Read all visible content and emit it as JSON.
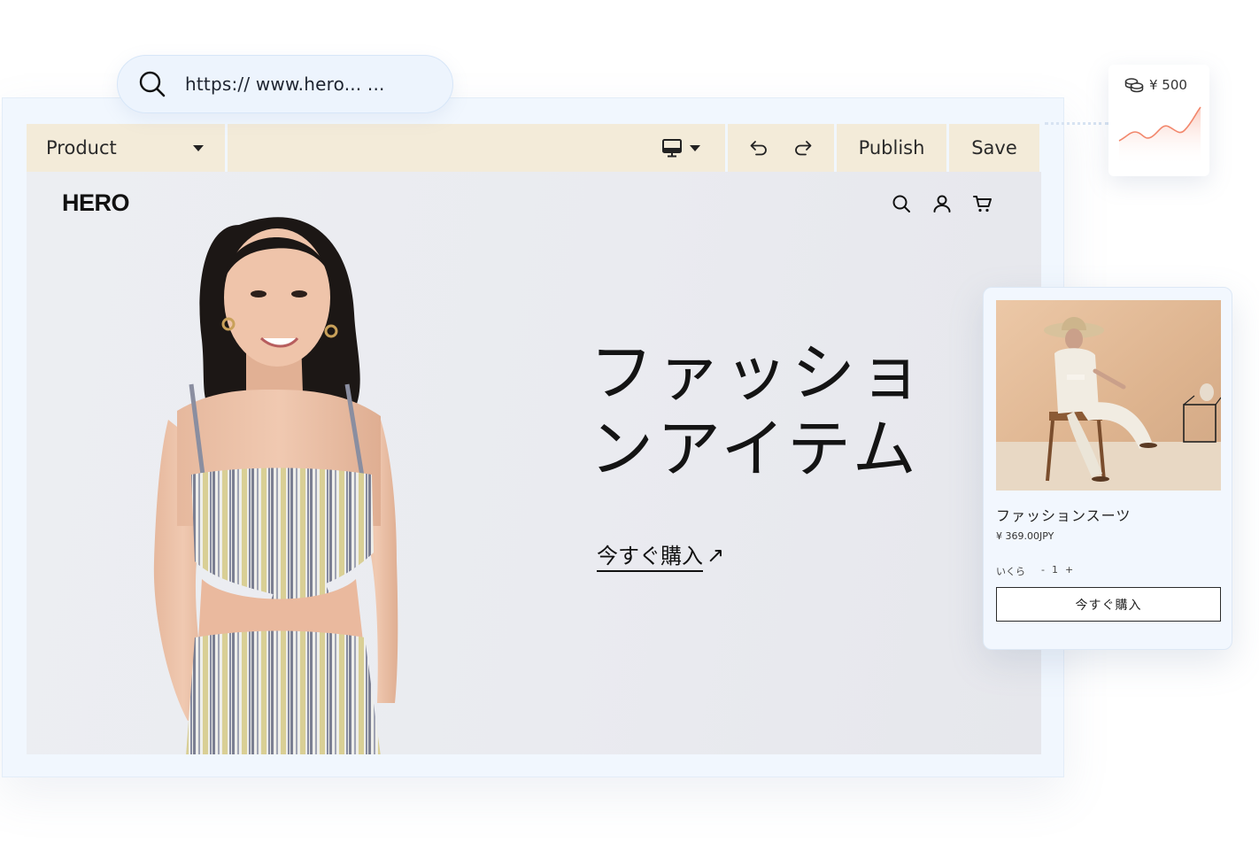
{
  "url_bar": {
    "url": "https:// www.hero... ..."
  },
  "toolbar": {
    "product_label": "Product",
    "publish_label": "Publish",
    "save_label": "Save",
    "icons": [
      "monitor-icon",
      "undo-icon",
      "redo-icon"
    ]
  },
  "site": {
    "logo": "HERO",
    "hero_title": "ファッショ ンアイテム",
    "buy_link_label": "今すぐ購入",
    "buy_link_arrow": "↗",
    "icons": [
      "search-icon",
      "user-icon",
      "cart-icon"
    ]
  },
  "revenue_card": {
    "amount": "¥ 500"
  },
  "product_card": {
    "name": "ファッションスーツ",
    "price": "¥ 369.00JPY",
    "quantity_label": "いくら",
    "quantity_minus": "-",
    "quantity_value": "1",
    "quantity_plus": "+",
    "buy_button_label": "今すぐ購入"
  },
  "colors": {
    "toolbar_bg": "#f3ebd9",
    "frame_bg": "#f1f7fe",
    "preview_bg": "#eaebf0",
    "accent_chart": "#f2876c"
  }
}
